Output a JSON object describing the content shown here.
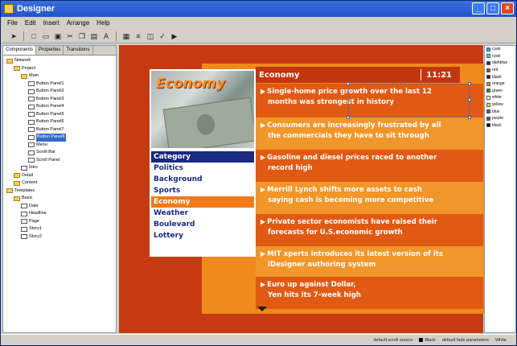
{
  "window": {
    "title": "Designer",
    "min": "_",
    "max": "□",
    "close": "×"
  },
  "menu": [
    "File",
    "Edit",
    "Insert",
    "Arrange",
    "Help"
  ],
  "toolbar_icons": [
    "pointer-icon",
    "new-icon",
    "open-icon",
    "save-icon",
    "cut-icon",
    "copy-icon",
    "paste-icon",
    "text-icon",
    "grid-icon",
    "align-icon",
    "layers-icon",
    "check-icon",
    "preview-icon"
  ],
  "left_panel": {
    "tabs": [
      "Components",
      "Properties",
      "Transitions"
    ],
    "tree": [
      {
        "label": "Network",
        "type": "folder",
        "indent": 0
      },
      {
        "label": "Project",
        "type": "folder",
        "indent": 1
      },
      {
        "label": "Main",
        "type": "folder",
        "indent": 2
      },
      {
        "label": "Button Panel1",
        "type": "page",
        "indent": 3
      },
      {
        "label": "Button Panel2",
        "type": "page",
        "indent": 3
      },
      {
        "label": "Button Panel3",
        "type": "page",
        "indent": 3
      },
      {
        "label": "Button Panel4",
        "type": "page",
        "indent": 3
      },
      {
        "label": "Button Panel5",
        "type": "page",
        "indent": 3
      },
      {
        "label": "Button Panel6",
        "type": "page",
        "indent": 3
      },
      {
        "label": "Button Panel7",
        "type": "page",
        "indent": 3
      },
      {
        "label": "Button Panel8",
        "type": "page",
        "indent": 3,
        "selected": true
      },
      {
        "label": "Menu",
        "type": "page",
        "indent": 3
      },
      {
        "label": "Scroll Bar",
        "type": "page",
        "indent": 3
      },
      {
        "label": "Scroll Panel",
        "type": "page",
        "indent": 3
      },
      {
        "label": "Intro",
        "type": "page",
        "indent": 2
      },
      {
        "label": "Detail",
        "type": "folder",
        "indent": 1
      },
      {
        "label": "Content",
        "type": "folder",
        "indent": 1
      },
      {
        "label": "Templates",
        "type": "folder",
        "indent": 0
      },
      {
        "label": "Basic",
        "type": "folder",
        "indent": 1
      },
      {
        "label": "Date",
        "type": "page",
        "indent": 2
      },
      {
        "label": "Headline",
        "type": "page",
        "indent": 2
      },
      {
        "label": "Page",
        "type": "page",
        "indent": 2
      },
      {
        "label": "Story1",
        "type": "page",
        "indent": 2
      },
      {
        "label": "Story2",
        "type": "page",
        "indent": 2
      }
    ]
  },
  "right_panel": [
    {
      "label": "cyan",
      "color": "#00c0d0"
    },
    {
      "label": "cyan",
      "color": "#40d0e0"
    },
    {
      "label": "darkblue",
      "color": "#1a2a80"
    },
    {
      "label": "red",
      "color": "#c63a12"
    },
    {
      "label": "black",
      "color": "#222222"
    },
    {
      "label": "orange",
      "color": "#ef8a1c"
    },
    {
      "label": "green",
      "color": "#2a8a3a"
    },
    {
      "label": "white",
      "color": "#ffffff"
    },
    {
      "label": "yellow",
      "color": "#ffd24a"
    },
    {
      "label": "blue",
      "color": "#3a5ac0"
    },
    {
      "label": "purple",
      "color": "#7a3a9a"
    },
    {
      "label": "black",
      "color": "#000000"
    }
  ],
  "graphic": {
    "section_title": "Economy",
    "time": "11:21",
    "image_title": "Economy",
    "categories_header": "Category",
    "categories": [
      "Politics",
      "Background",
      "Sports",
      "Economy",
      "Weather",
      "Boulevard",
      "Lottery"
    ],
    "active_category": "Economy",
    "headlines": [
      {
        "line1": "Single-home price growth over the last 12",
        "line2": "months was strongest in history"
      },
      {
        "line1": "Consumers are increasingly frustrated by all",
        "line2": "the commercials they have to sit through"
      },
      {
        "line1": "Gasoline and diesel prices raced to another",
        "line2": "record high"
      },
      {
        "line1": "Merrill Lynch shifts more assets to cash",
        "line2": "saying cash is becoming more competitive"
      },
      {
        "line1": "Private sector economists have raised their",
        "line2": "forecasts for U.S.economic growth"
      },
      {
        "line1": "MIT xperts introduces its latest version of its",
        "line2": "iDesigner authoring system"
      },
      {
        "line1": "Euro up against Dollar,",
        "line2": "Yen hits its 7-week high"
      }
    ]
  },
  "status": {
    "left": "default scroll source",
    "middle": "Black",
    "right": "default fade parameters",
    "far_right": "White"
  }
}
